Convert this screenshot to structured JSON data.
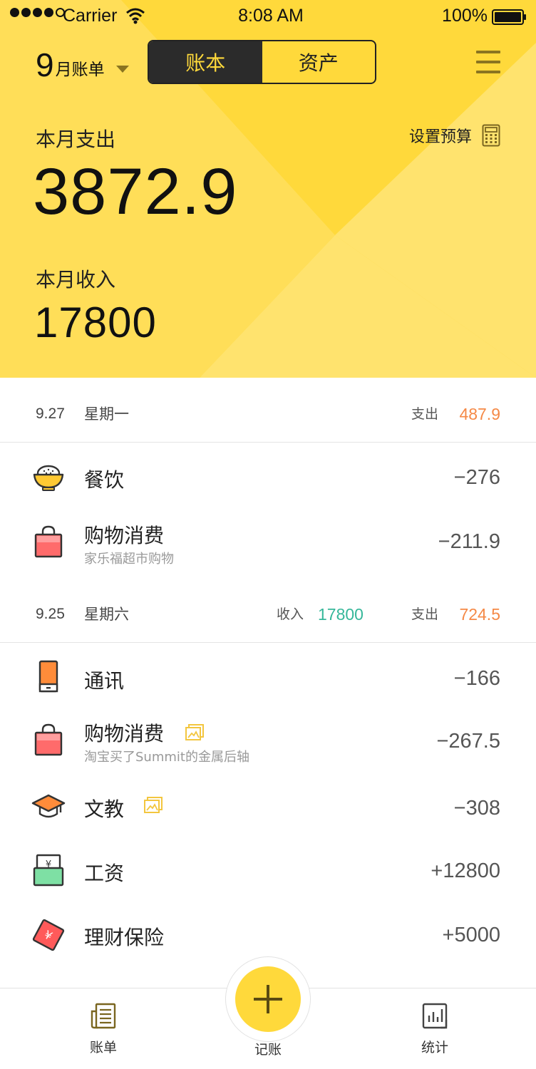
{
  "status_bar": {
    "carrier": "Carrier",
    "time": "8:08 AM",
    "battery": "100%"
  },
  "header": {
    "month_num": "9",
    "month_label": "月账单",
    "segments": [
      "账本",
      "资产"
    ],
    "expense_label": "本月支出",
    "expense_value": "3872.9",
    "budget_label": "设置预算",
    "income_label": "本月收入",
    "income_value": "17800"
  },
  "days": [
    {
      "date": "9.27",
      "weekday": "星期一",
      "expense_tag": "支出",
      "expense": "487.9",
      "items": [
        {
          "icon": "rice-bowl-icon",
          "title": "餐饮",
          "amount": "−276"
        },
        {
          "icon": "shopping-bag-icon",
          "title": "购物消费",
          "note": "家乐福超市购物",
          "amount": "−211.9"
        }
      ]
    },
    {
      "date": "9.25",
      "weekday": "星期六",
      "income_tag": "收入",
      "income": "17800",
      "expense_tag": "支出",
      "expense": "724.5",
      "items": [
        {
          "icon": "phone-icon",
          "title": "通讯",
          "amount": "−166"
        },
        {
          "icon": "shopping-bag-icon",
          "title": "购物消费",
          "note": "淘宝买了Summit的金属后轴",
          "amount": "−267.5"
        },
        {
          "icon": "graduation-cap-icon",
          "title": "文教",
          "amount": "−308"
        },
        {
          "icon": "salary-envelope-icon",
          "title": "工资",
          "amount": "+12800"
        },
        {
          "icon": "finance-ticket-icon",
          "title": "理财保险",
          "amount": "+5000"
        }
      ]
    }
  ],
  "tabbar": {
    "bills": "账单",
    "add": "记账",
    "stats": "统计"
  },
  "colors": {
    "header_yellow": "#FFD93B",
    "expense": "#F58946",
    "income": "#36B79A",
    "dark": "#2b2b2b"
  }
}
